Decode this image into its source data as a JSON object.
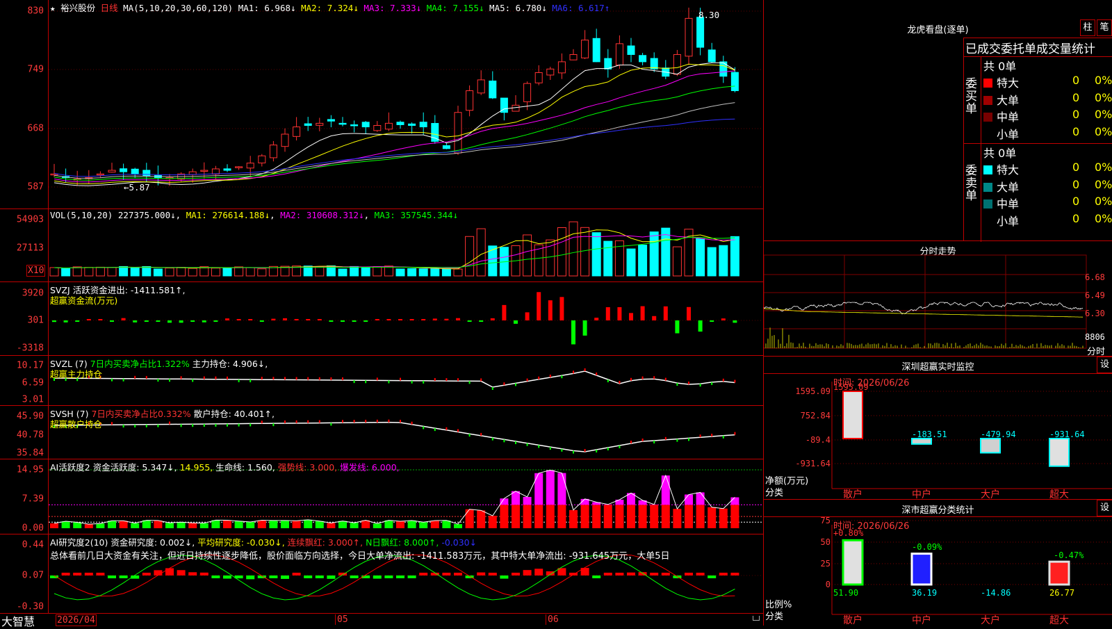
{
  "stock": {
    "name": "裕兴股份",
    "period": "日线",
    "star": "★"
  },
  "colors": {
    "up": "#ff3232",
    "down": "#00ffff",
    "frame": "#c00000",
    "yellow": "#ffff00",
    "magenta": "#ff00ff",
    "green": "#00ff00",
    "blue": "#4040ff",
    "axis_text": "#ff3b3b"
  },
  "main": {
    "header": {
      "ma_params": "MA(5,10,20,30,60,120)",
      "ma1": "MA1: 6.968↓",
      "ma2": "MA2: 7.324↓",
      "ma3": "MA3: 7.333↓",
      "ma4": "MA4: 7.155↓",
      "ma5": "MA5: 6.780↓",
      "ma6": "MA6: 6.617↑"
    },
    "yticks": [
      "830",
      "749",
      "668",
      "587"
    ],
    "high_label": "8.30",
    "low_label": "←5.87"
  },
  "vol": {
    "header": {
      "label": "VOL(5,10,20)",
      "value": "227375.000↓",
      "ma1": "MA1: 276614.188↓",
      "ma2": "MA2: 310608.312↓",
      "ma3": "MA3: 357545.344↓"
    },
    "yticks": [
      "54903",
      "27113"
    ],
    "unit": "X10"
  },
  "svzj": {
    "header": {
      "label": "SVZJ  活跃资金进出: -1411.581↑,",
      "line2": "超赢资金流(万元)"
    },
    "yticks": [
      "3920",
      "301",
      "-3318"
    ]
  },
  "svzl": {
    "header": {
      "label": "SVZL (7)",
      "pct": "7日内买卖净占比1.322%",
      "pos": "主力持仓: 4.906↓,",
      "line2": "超赢主力持仓"
    },
    "yticks": [
      "10.17",
      "6.59",
      "3.01"
    ]
  },
  "svsh": {
    "header": {
      "label": "SVSH (7)",
      "pct": "7日内买卖净占比0.332%",
      "pos": "散户持仓: 40.401↑,",
      "line2": "超赢散户持仓"
    },
    "yticks": [
      "45.90",
      "40.78",
      "35.84"
    ]
  },
  "ai1": {
    "header": {
      "label": "AI活跃度2",
      "a": "资金活跃度: 5.347↓,",
      "b": "14.955,",
      "c": "生命线: 1.560,",
      "d": "强势线: 3.000,",
      "e": "爆发线: 6.000,"
    },
    "yticks": [
      "14.95",
      "7.39",
      "0.00"
    ]
  },
  "ai2": {
    "header": {
      "label": "AI研究度2(10)",
      "a": "资金研究度: 0.002↓,",
      "b": "平均研究度: -0.030↓,",
      "c": "连续飘红: 3.000↑,",
      "d": "N日飘红: 8.000↑,",
      "e": "-0.030↓"
    },
    "comment": "总体看前几日大资金有关注，但近日持续性逐步降低，股价面临方向选择，今日大单净流出: -1411.583万元，其中特大单净流出: -931.645万元，大单5日",
    "yticks": [
      "0.44",
      "0.07",
      "-0.30"
    ]
  },
  "xaxis": {
    "brand": "大智慧",
    "labels": [
      "2026/04",
      "05",
      "06"
    ]
  },
  "dragon": {
    "title": "龙虎看盘(逐单)",
    "btn1": "柱",
    "btn2": "笔",
    "subtitle": "已成交委托单成交量统计",
    "buy": {
      "side": "委买单",
      "total": "共 0单",
      "rows": [
        {
          "label": "特大",
          "v": "0",
          "p": "0%",
          "color": "#ff0000"
        },
        {
          "label": "大单",
          "v": "0",
          "p": "0%",
          "color": "#a00000"
        },
        {
          "label": "中单",
          "v": "0",
          "p": "0%",
          "color": "#780000"
        },
        {
          "label": "小单",
          "v": "0",
          "p": "0%",
          "color": "#000000"
        }
      ]
    },
    "sell": {
      "side": "委卖单",
      "total": "共 0单",
      "rows": [
        {
          "label": "特大",
          "v": "0",
          "p": "0%",
          "color": "#00ffff"
        },
        {
          "label": "大单",
          "v": "0",
          "p": "0%",
          "color": "#008888"
        },
        {
          "label": "中单",
          "v": "0",
          "p": "0%",
          "color": "#007070"
        },
        {
          "label": "小单",
          "v": "0",
          "p": "0%",
          "color": "#000000"
        }
      ]
    }
  },
  "intraday": {
    "title": "分时走势",
    "yticks": [
      "6.68",
      "6.49",
      "6.30"
    ],
    "vol_label": "8806",
    "bottom": "分时"
  },
  "sz_monitor": {
    "title": "深圳超赢实时监控",
    "btn": "设",
    "time": "时间: 2026/06/26",
    "yticks": [
      "1595.09",
      "752.84",
      "-89.4",
      "-931.64"
    ],
    "ylabel": "净额(万元)",
    "xlabel": "分类",
    "cats": [
      "散户",
      "中户",
      "大户",
      "超大"
    ],
    "values": [
      "1595.09",
      "-183.51",
      "-479.94",
      "-931.64"
    ],
    "nums": [
      1595.09,
      -183.51,
      -479.94,
      -931.64
    ]
  },
  "sz_class": {
    "title": "深市超赢分类统计",
    "btn": "设",
    "time": "时间: 2026/06/26",
    "yticks": [
      "75",
      "50",
      "25",
      "0"
    ],
    "ylabel": "比例%",
    "xlabel": "分类",
    "cats": [
      "散户",
      "中户",
      "大户",
      "超大"
    ],
    "top": [
      "+0.80%",
      "-0.09%",
      "",
      "-0.47%"
    ],
    "bottom": [
      "51.90",
      "36.19",
      "-14.86",
      "26.77"
    ],
    "nums": [
      51.9,
      36.19,
      -14.86,
      26.77
    ]
  }
}
